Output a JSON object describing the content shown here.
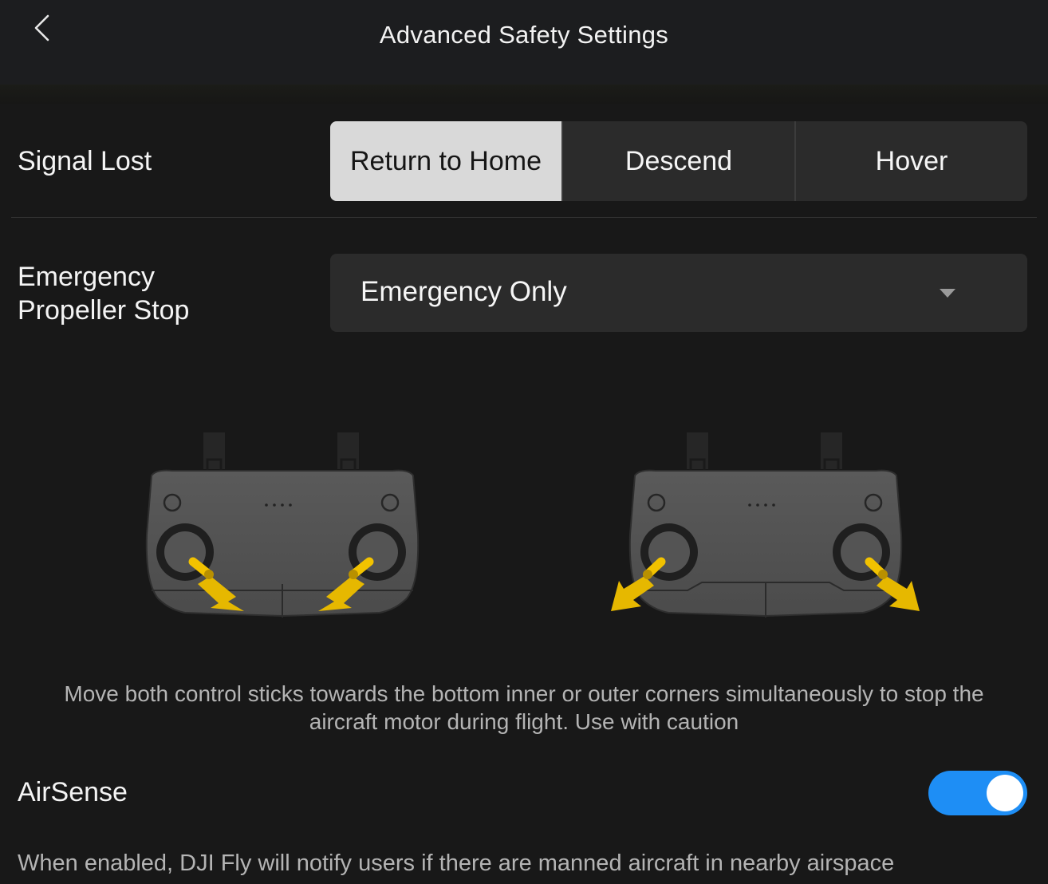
{
  "header": {
    "title": "Advanced Safety Settings",
    "back_icon": "chevron-left-icon"
  },
  "signal_lost": {
    "label": "Signal Lost",
    "options": [
      "Return to Home",
      "Descend",
      "Hover"
    ],
    "selected": "Return to Home"
  },
  "emergency_stop": {
    "label_line1": "Emergency",
    "label_line2": "Propeller Stop",
    "value": "Emergency Only",
    "dropdown_icon": "triangle-down-icon",
    "illustrations": [
      "remote-controller-inner-corners",
      "remote-controller-outer-corners"
    ],
    "caption_line1": "Move both control sticks towards the bottom inner or outer corners simultaneously to stop the",
    "caption_line2": "aircraft motor during flight. Use with caution"
  },
  "airsense": {
    "label": "AirSense",
    "enabled": true,
    "description": "When enabled, DJI Fly will notify users if there are manned aircraft in nearby airspace"
  },
  "colors": {
    "background": "#181818",
    "control_bg": "#2b2b2b",
    "selected_segment": "#d9d9d9",
    "toggle_on": "#1e8ef5",
    "arrow_yellow": "#f2c200"
  }
}
